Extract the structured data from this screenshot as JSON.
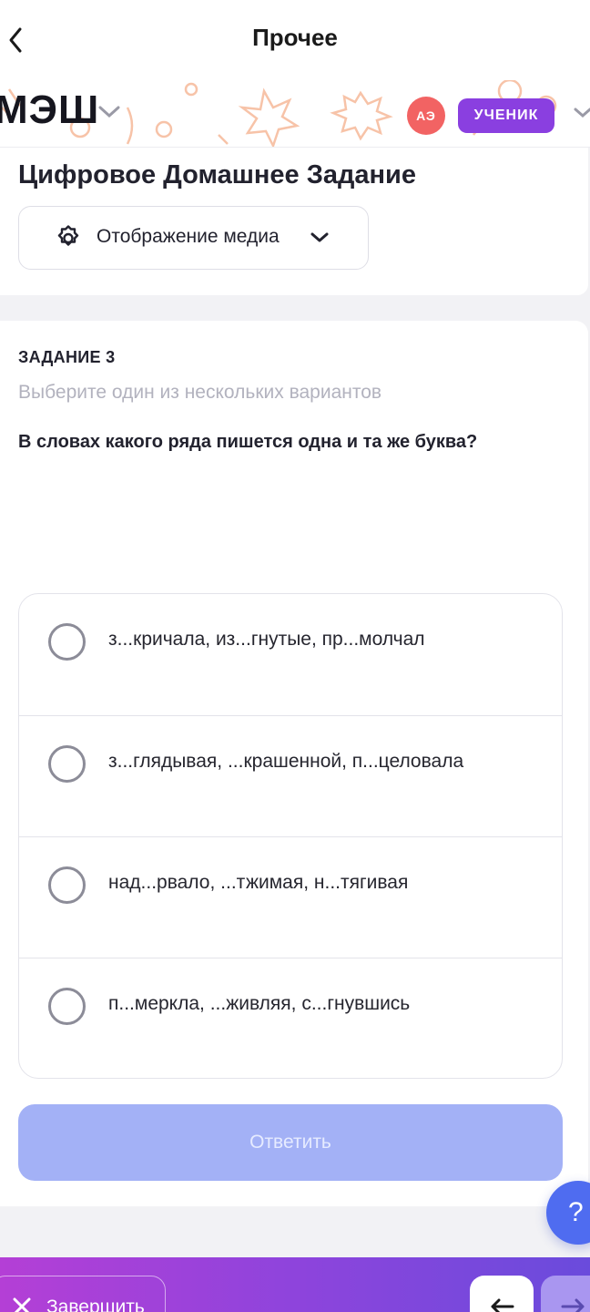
{
  "header": {
    "title": "Прочее",
    "back_icon": "chevron-left-icon"
  },
  "banner": {
    "logo_text": "МЭШ",
    "avatar_initials": "АЭ",
    "role_label": "УЧЕНИК",
    "avatar_color": "#f26363",
    "role_color": "#8a3fe0"
  },
  "section": {
    "title": "Цифровое Домашнее Задание",
    "media_dropdown_label": "Отображение медиа"
  },
  "task": {
    "number_label": "ЗАДАНИЕ 3",
    "hint": "Выберите один из нескольких вариантов",
    "question": "В словах какого ряда пишется одна и та же буква?",
    "options": [
      {
        "text": "з...кричала, из...гнутые, пр...молчал",
        "selected": false
      },
      {
        "text": "з...глядывая, ...крашенной, п...целовала",
        "selected": false
      },
      {
        "text": "над...рвало, ...тжимая, н...тягивая",
        "selected": false
      },
      {
        "text": "п...меркла, ...живляя, с...гнувшись",
        "selected": false
      }
    ],
    "submit_label": "Ответить"
  },
  "help": {
    "label": "?"
  },
  "footer": {
    "finish_label": "Завершить",
    "accent_gradient": [
      "#b43fd6",
      "#6a4bdc"
    ]
  }
}
